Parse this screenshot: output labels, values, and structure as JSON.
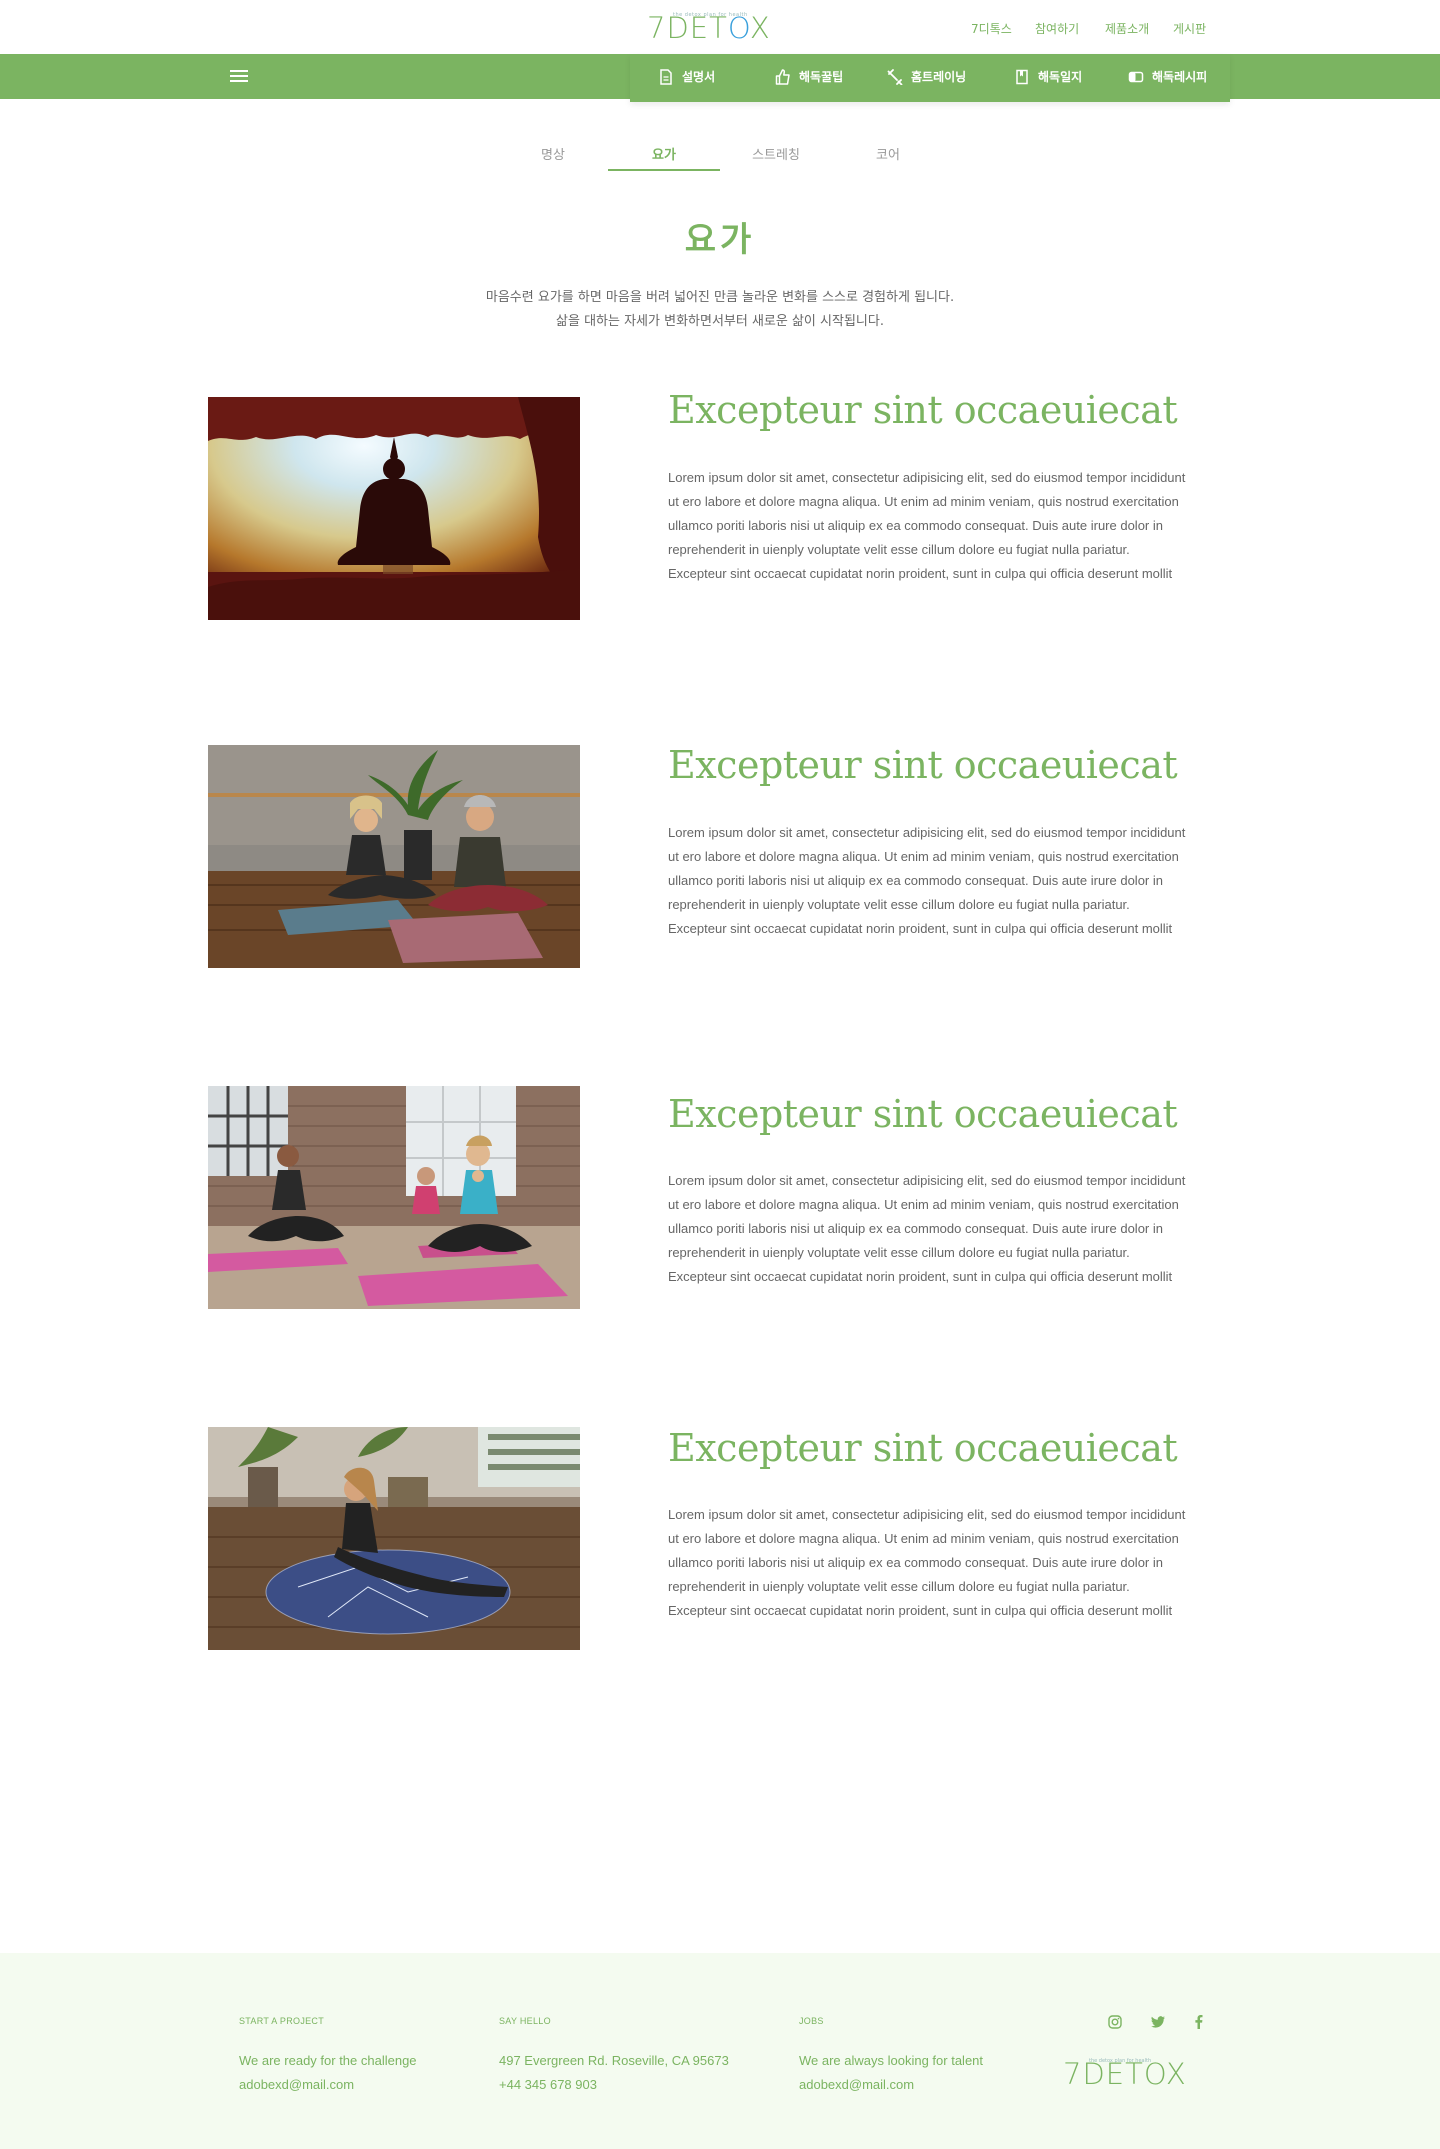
{
  "brand": {
    "logo_text_seven": "7",
    "logo_text_de": "DET",
    "logo_text_o": "O",
    "logo_text_x": "X",
    "logo_tagline": "the detox plan for health",
    "accent_color": "#7bb461",
    "logo_o_color": "#3aa0dc"
  },
  "top_nav": [
    {
      "label": "7디톡스"
    },
    {
      "label": "참여하기"
    },
    {
      "label": "제품소개"
    },
    {
      "label": "게시판"
    }
  ],
  "main_nav": [
    {
      "label": "설명서",
      "icon": "document-icon"
    },
    {
      "label": "해독꿀팁",
      "icon": "thumbs-up-icon"
    },
    {
      "label": "홈트레이닝",
      "icon": "dumbbell-icon"
    },
    {
      "label": "해독일지",
      "icon": "journal-icon"
    },
    {
      "label": "해독레시피",
      "icon": "recipe-icon"
    }
  ],
  "tabs": [
    {
      "label": "명상",
      "active": false
    },
    {
      "label": "요가",
      "active": true
    },
    {
      "label": "스트레칭",
      "active": false
    },
    {
      "label": "코어",
      "active": false
    }
  ],
  "page": {
    "title": "요가",
    "desc_line1": "마음수련 요가를 하면 마음을 버려 넓어진 만큼 놀라운 변화를 스스로 경험하게 됩니다.",
    "desc_line2": "삶을 대하는 자세가 변화하면서부터 새로운 삶이 시작됩니다."
  },
  "cards": [
    {
      "title": "Excepteur sint occaeuiecat",
      "image": "yoga-sunset-silhouette",
      "lines": [
        "Lorem ipsum dolor sit amet, consectetur adipisicing elit, sed do eiusmod tempor incididunt",
        "ut ero labore et dolore magna aliqua. Ut enim ad minim veniam, quis nostrud exercitation",
        "ullamco poriti laboris nisi ut aliquip ex ea commodo consequat. Duis aute irure dolor in",
        "reprehenderit in uienply voluptate velit esse cillum dolore eu fugiat nulla pariatur.",
        "Excepteur sint occaecat cupidatat norin proident, sunt in culpa qui officia deserunt mollit"
      ]
    },
    {
      "title": "Excepteur sint occaeuiecat",
      "image": "yoga-couple-meditation",
      "lines": [
        "Lorem ipsum dolor sit amet, consectetur adipisicing elit, sed do eiusmod tempor incididunt",
        "ut ero labore et dolore magna aliqua. Ut enim ad minim veniam, quis nostrud exercitation",
        "ullamco poriti laboris nisi ut aliquip ex ea commodo consequat. Duis aute irure dolor in",
        "reprehenderit in uienply voluptate velit esse cillum dolore eu fugiat nulla pariatur.",
        "Excepteur sint occaecat cupidatat norin proident, sunt in culpa qui officia deserunt mollit"
      ]
    },
    {
      "title": "Excepteur sint occaeuiecat",
      "image": "yoga-class-pink-mats",
      "lines": [
        "Lorem ipsum dolor sit amet, consectetur adipisicing elit, sed do eiusmod tempor incididunt",
        "ut ero labore et dolore magna aliqua. Ut enim ad minim veniam, quis nostrud exercitation",
        "ullamco poriti laboris nisi ut aliquip ex ea commodo consequat. Duis aute irure dolor in",
        "reprehenderit in uienply voluptate velit esse cillum dolore eu fugiat nulla pariatur.",
        "Excepteur sint occaecat cupidatat norin proident, sunt in culpa qui officia deserunt mollit"
      ]
    },
    {
      "title": "Excepteur sint occaeuiecat",
      "image": "yoga-round-mat-stretch",
      "lines": [
        "Lorem ipsum dolor sit amet, consectetur adipisicing elit, sed do eiusmod tempor incididunt",
        "ut ero labore et dolore magna aliqua. Ut enim ad minim veniam, quis nostrud exercitation",
        "ullamco poriti laboris nisi ut aliquip ex ea commodo consequat. Duis aute irure dolor in",
        "reprehenderit in uienply voluptate velit esse cillum dolore eu fugiat nulla pariatur.",
        "Excepteur sint occaecat cupidatat norin proident, sunt in culpa qui officia deserunt mollit"
      ]
    }
  ],
  "footer": {
    "col1": {
      "heading": "START A PROJECT",
      "line1": "We are ready for the challenge",
      "line2": "adobexd@mail.com"
    },
    "col2": {
      "heading": "SAY HELLO",
      "line1": "497 Evergreen Rd. Roseville, CA 95673",
      "line2": "+44 345 678 903"
    },
    "col3": {
      "heading": "JOBS",
      "line1": "We are always looking for talent",
      "line2": "adobexd@mail.com"
    },
    "social": [
      "instagram-icon",
      "twitter-icon",
      "facebook-icon"
    ]
  }
}
